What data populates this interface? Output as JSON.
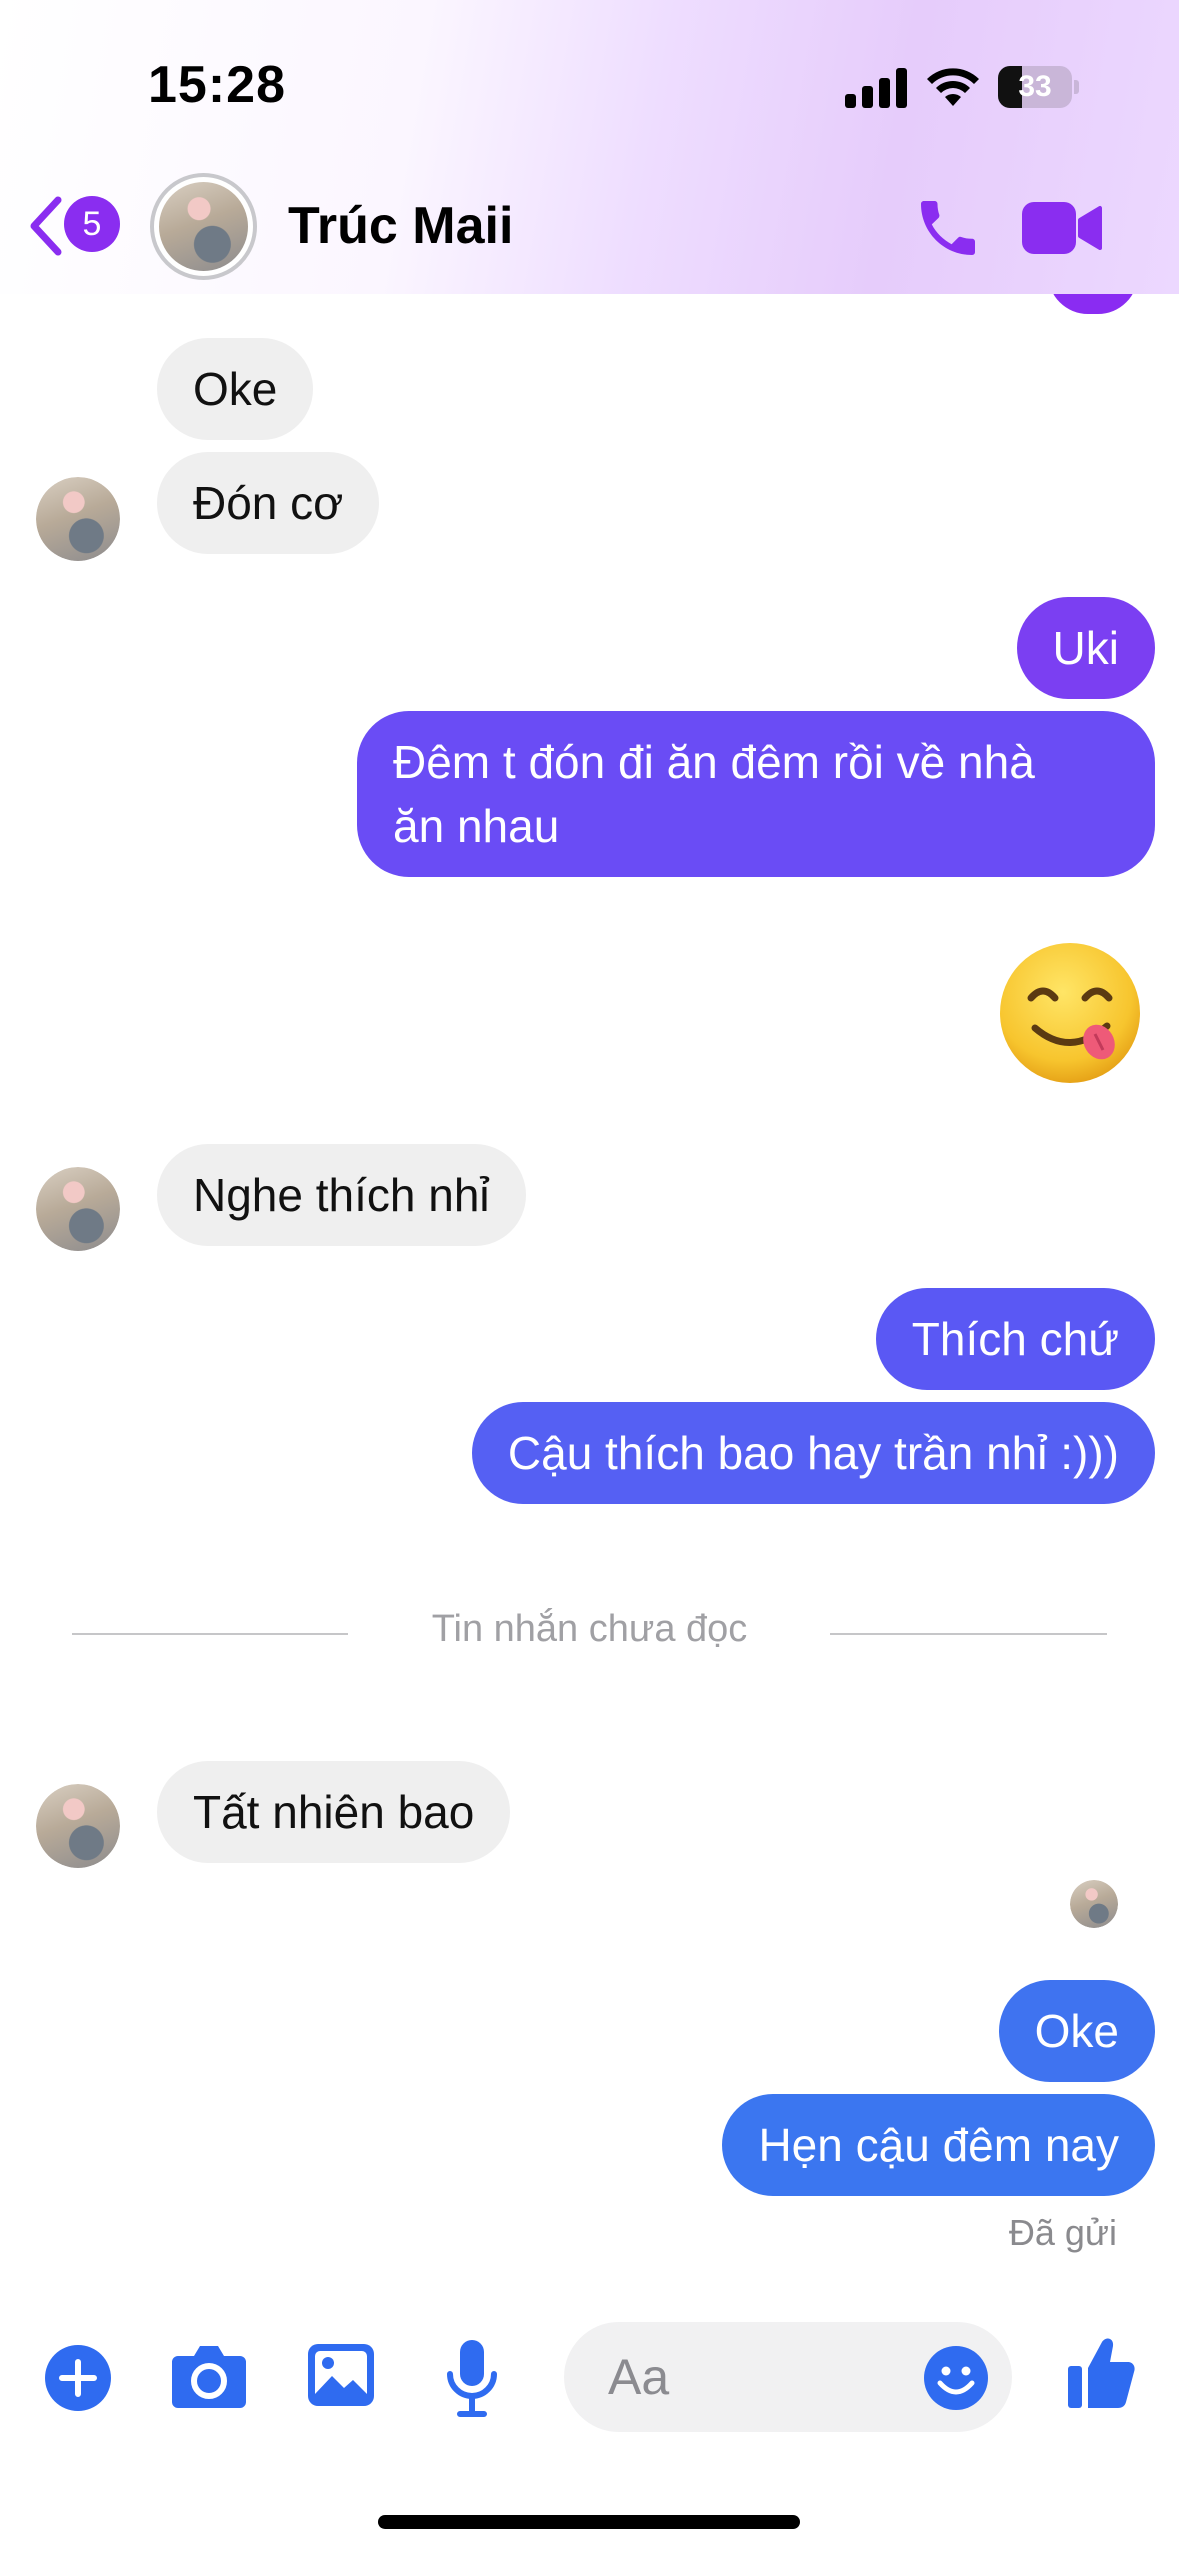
{
  "status_bar": {
    "time": "15:28",
    "battery": "33",
    "battery_level_percent": 33
  },
  "header": {
    "back_badge": "5",
    "contact_name": "Trúc Maii",
    "icons": [
      "back-chevron-icon",
      "phone-icon",
      "video-camera-icon"
    ],
    "accent_color": "#8a2df0"
  },
  "messages": [
    {
      "from": "them",
      "text": "Oke"
    },
    {
      "from": "them",
      "text": "Đón cơ"
    },
    {
      "from": "me",
      "text": "Uki",
      "color": "#7b3ff2"
    },
    {
      "from": "me",
      "text_line1": "Đêm t đón đi ăn đêm rồi về nhà",
      "text_line2": "ăn nhau",
      "color": "#6a4cf5"
    },
    {
      "from": "me",
      "emoji": "face-savoring-food-emoji"
    },
    {
      "from": "them",
      "text": "Nghe thích nhỉ"
    },
    {
      "from": "me",
      "text": "Thích chứ",
      "color": "#5a58f4"
    },
    {
      "from": "me",
      "text": "Cậu thích bao hay trần nhỉ :)))",
      "color": "#5560f3"
    },
    {
      "from": "them",
      "text": "Tất nhiên bao"
    },
    {
      "from": "me",
      "text": "Oke",
      "color": "#3f73f0"
    },
    {
      "from": "me",
      "text": "Hẹn cậu đêm nay",
      "color": "#3b76f0"
    }
  ],
  "unread_divider": "Tin nhắn chưa đọc",
  "sent_status": "Đã gửi",
  "composer": {
    "placeholder": "Aa",
    "icons": [
      "plus-icon",
      "camera-icon",
      "image-icon",
      "microphone-icon",
      "emoji-icon",
      "thumbs-up-icon"
    ],
    "icon_color": "#2f6bf0"
  }
}
